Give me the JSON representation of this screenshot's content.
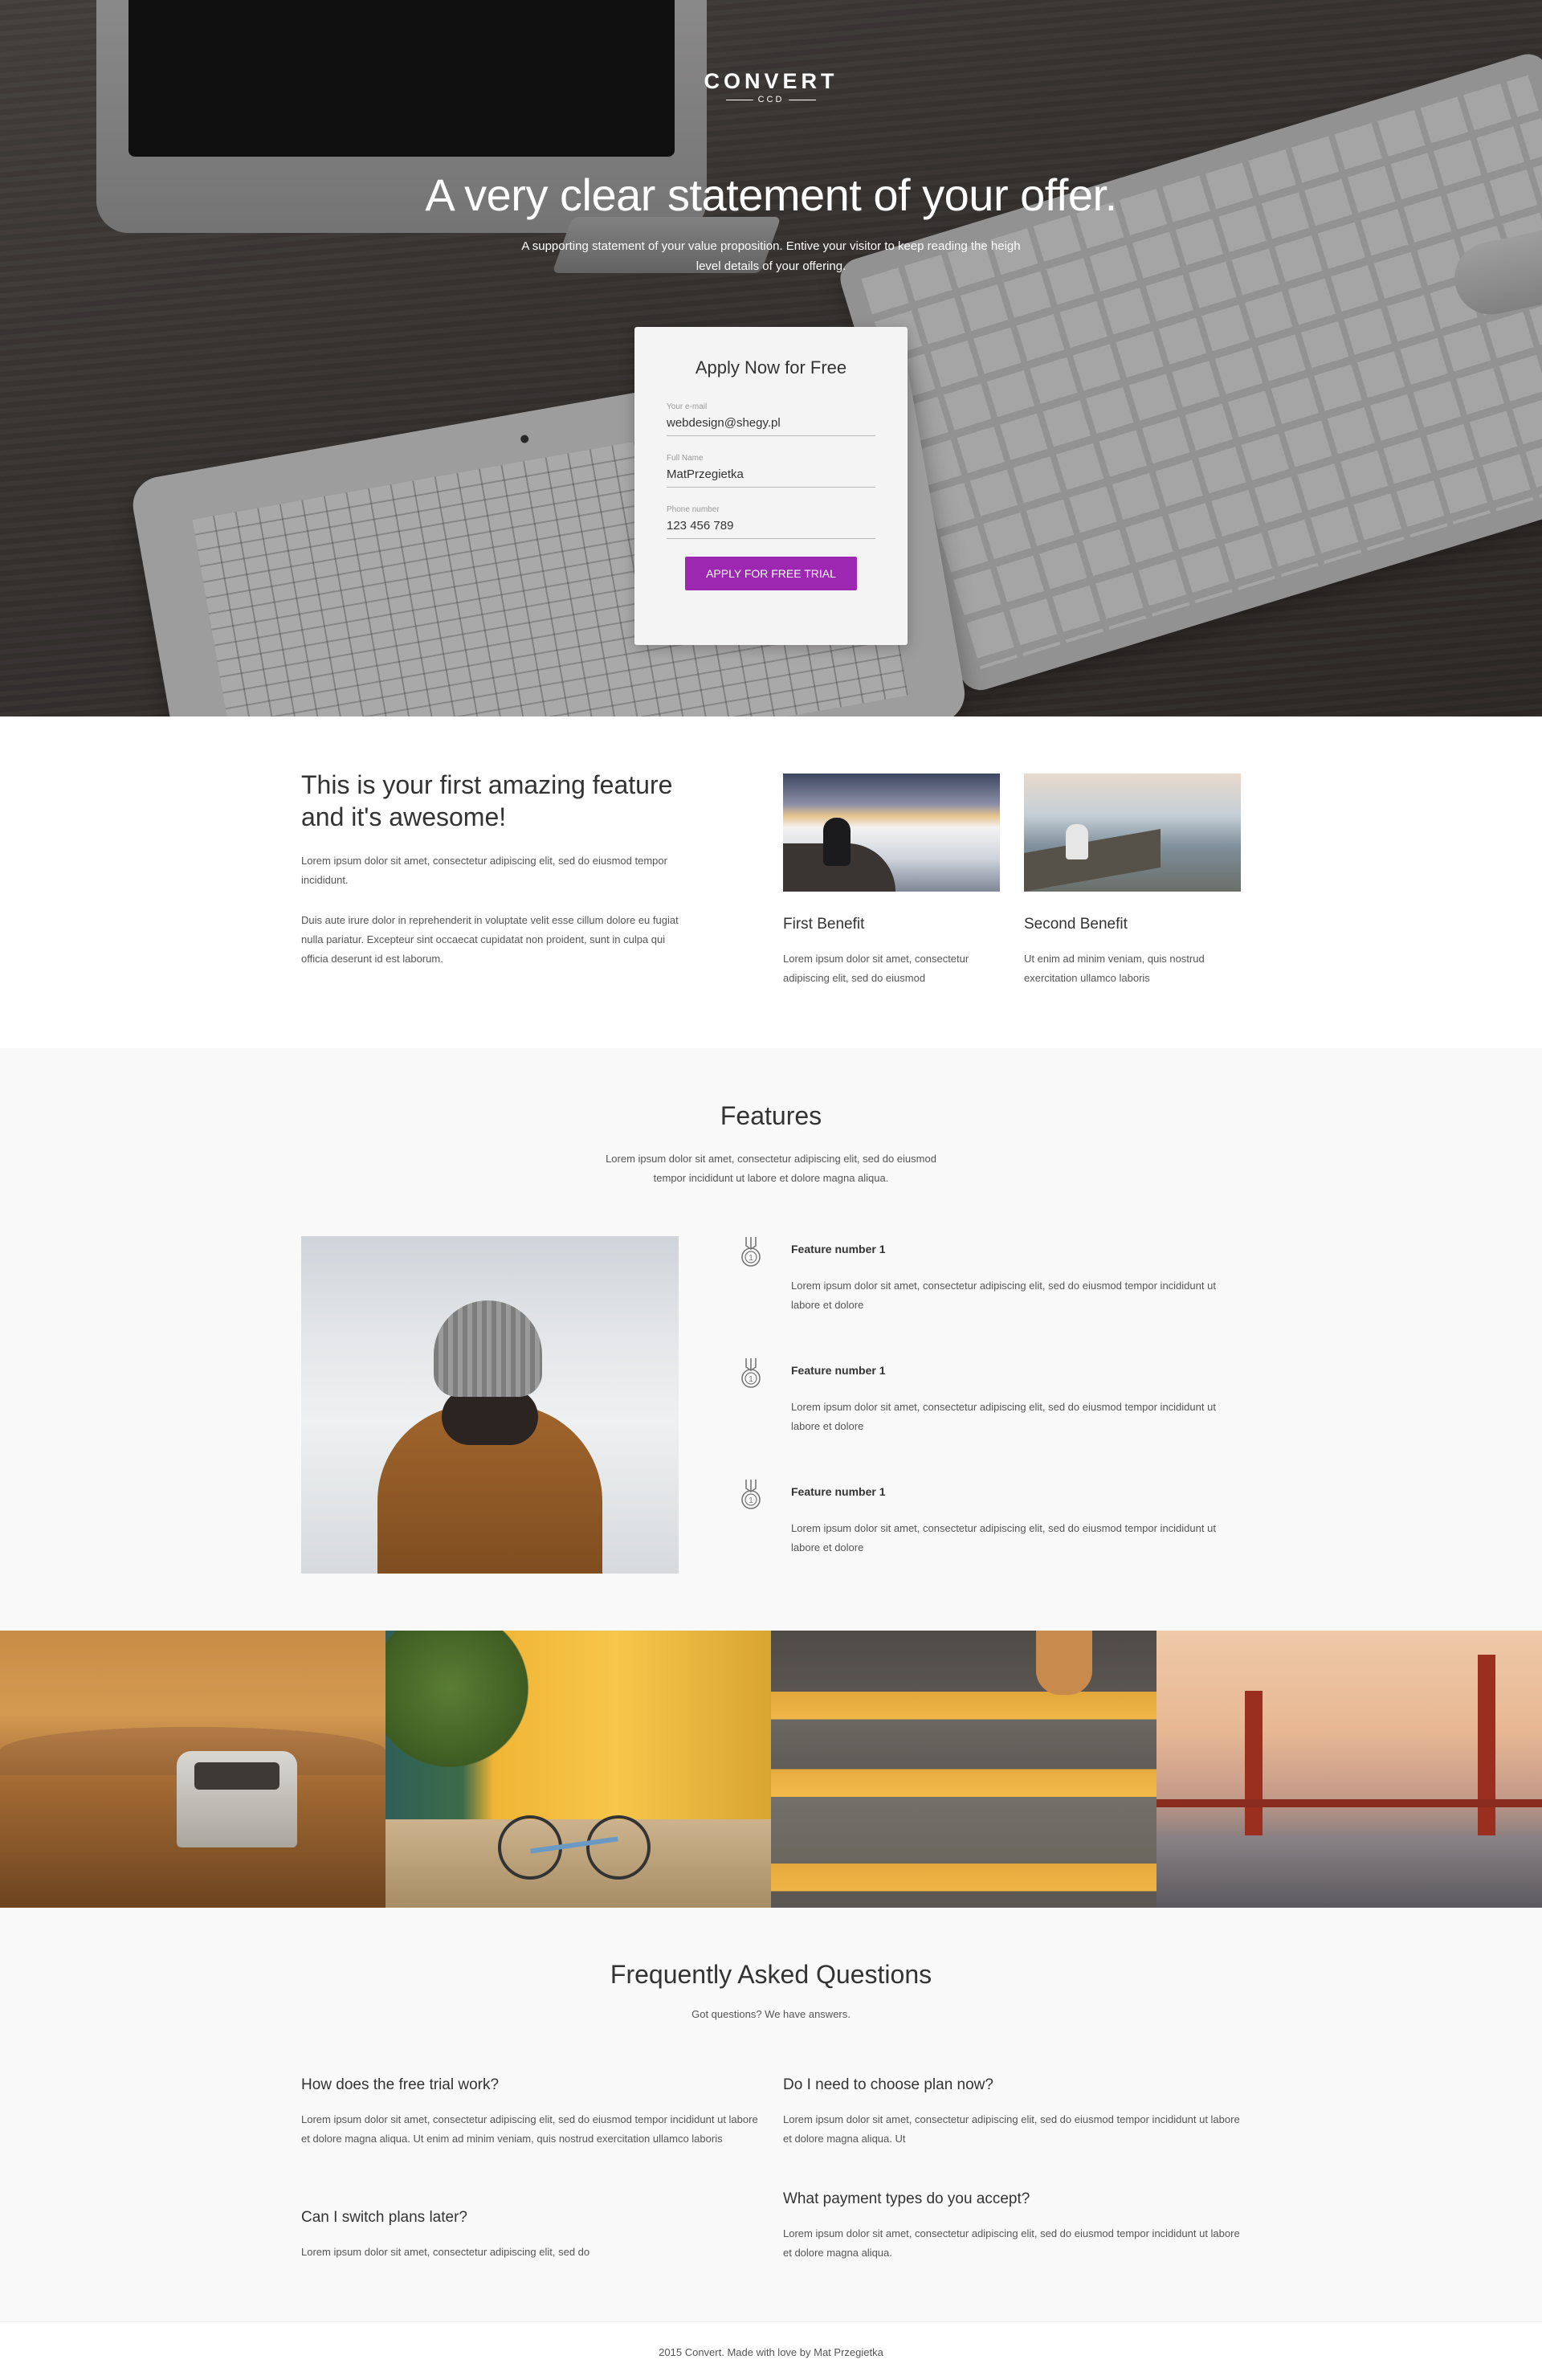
{
  "logo": {
    "word": "CONVERT",
    "sub": "CCD"
  },
  "hero": {
    "title": "A very clear statement of your offer.",
    "subtitle": "A supporting statement of your value proposition. Entive your visitor to keep reading the heigh level details of your offering."
  },
  "form": {
    "title": "Apply Now for Free",
    "fields": [
      {
        "label": "Your e-mail",
        "value": "webdesign@shegy.pl"
      },
      {
        "label": "Full Name",
        "value": "MatPrzegietka"
      },
      {
        "label": "Phone number",
        "value": "123 456 789"
      }
    ],
    "cta": "APPLY FOR FREE TRIAL",
    "cta_color": "#9c27b0"
  },
  "first_feature": {
    "title": "This is your first amazing feature and it's awesome!",
    "p1": "Lorem ipsum dolor sit amet, consectetur adipiscing elit, sed do eiusmod tempor incididunt.",
    "p2": "Duis aute irure dolor in reprehenderit in voluptate velit esse cillum dolore eu fugiat nulla pariatur. Excepteur sint occaecat cupidatat non proident, sunt in culpa qui officia deserunt id est laborum.",
    "benefits": [
      {
        "title": "First Benefit",
        "text": "Lorem ipsum dolor sit amet, consectetur adipiscing elit, sed do eiusmod"
      },
      {
        "title": "Second Benefit",
        "text": "Ut enim ad minim veniam, quis nostrud exercitation ullamco laboris"
      }
    ]
  },
  "features": {
    "title": "Features",
    "subtitle": "Lorem ipsum dolor sit amet, consectetur adipiscing elit, sed do eiusmod tempor incididunt ut labore et dolore magna aliqua.",
    "items": [
      {
        "icon": "medal-icon",
        "title": "Feature number 1",
        "text": "Lorem ipsum dolor sit amet, consectetur adipiscing elit, sed do eiusmod tempor incididunt ut labore et dolore"
      },
      {
        "icon": "medal-icon",
        "title": "Feature number 1",
        "text": "Lorem ipsum dolor sit amet, consectetur adipiscing elit, sed do eiusmod tempor incididunt ut labore et dolore"
      },
      {
        "icon": "medal-icon",
        "title": "Feature number 1",
        "text": "Lorem ipsum dolor sit amet, consectetur adipiscing elit, sed do eiusmod tempor incididunt ut labore et dolore"
      }
    ]
  },
  "faq": {
    "title": "Frequently Asked Questions",
    "subtitle": "Got questions? We have answers.",
    "items": [
      {
        "q": "How does the free trial work?",
        "a": "Lorem ipsum dolor sit amet, consectetur adipiscing elit, sed do eiusmod tempor incididunt ut labore et dolore magna aliqua. Ut enim ad minim veniam, quis nostrud exercitation ullamco laboris"
      },
      {
        "q": "Do I need to choose plan now?",
        "a": "Lorem ipsum dolor sit amet, consectetur adipiscing elit, sed do eiusmod tempor incididunt ut labore et dolore magna aliqua. Ut"
      },
      {
        "q": "Can I switch plans later?",
        "a": "Lorem ipsum dolor sit amet, consectetur adipiscing elit, sed do"
      },
      {
        "q": "What payment types do you accept?",
        "a": "Lorem ipsum dolor sit amet, consectetur adipiscing elit, sed do eiusmod tempor incididunt ut labore et dolore magna aliqua."
      }
    ]
  },
  "footer": {
    "copyright": "2015 Convert. Made with love by Mat Przegietka"
  }
}
